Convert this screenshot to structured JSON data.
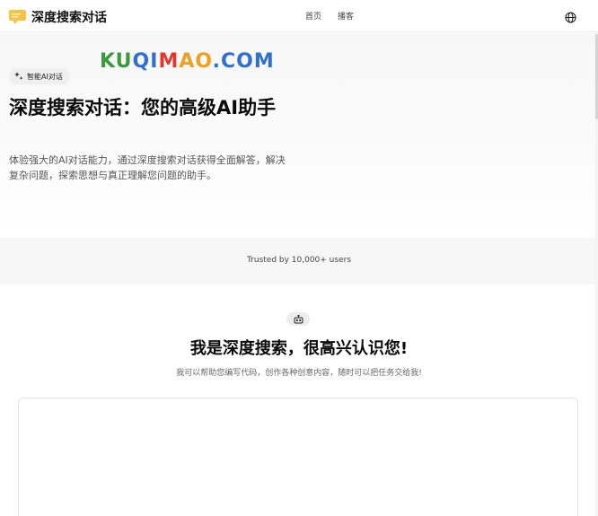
{
  "header": {
    "brand": "深度搜索对话",
    "nav": [
      "首页",
      "播客"
    ],
    "language_icon": "globe-icon"
  },
  "watermark": {
    "letters": [
      "K",
      "U",
      "Q",
      "I",
      "M",
      "A",
      "O",
      ".",
      "C",
      "O",
      "M"
    ],
    "colors": [
      "#3a9a3a",
      "#3a9a3a",
      "#2f6fd0",
      "#2f6fd0",
      "#e0392b",
      "#f0a020",
      "#f0a020",
      "#2f6fd0",
      "#2f6fd0",
      "#2f6fd0",
      "#2f6fd0"
    ]
  },
  "hero": {
    "badge": "智能AI对话",
    "title": "深度搜索对话：您的高级AI助手",
    "description": "体验强大的AI对话能力，通过深度搜索对话获得全面解答，解决复杂问题，探索思想与真正理解您问题的助手。"
  },
  "trusted": "Trusted by 10,000+ users",
  "chat": {
    "title": "我是深度搜索，很高兴认识您!",
    "subtitle": "我可以帮助您编写代码，创作各种创意内容，随时可以把任务交给我!"
  },
  "colors": {
    "logo_yellow": "#f6c343",
    "text_dark": "#0b0b0b"
  }
}
